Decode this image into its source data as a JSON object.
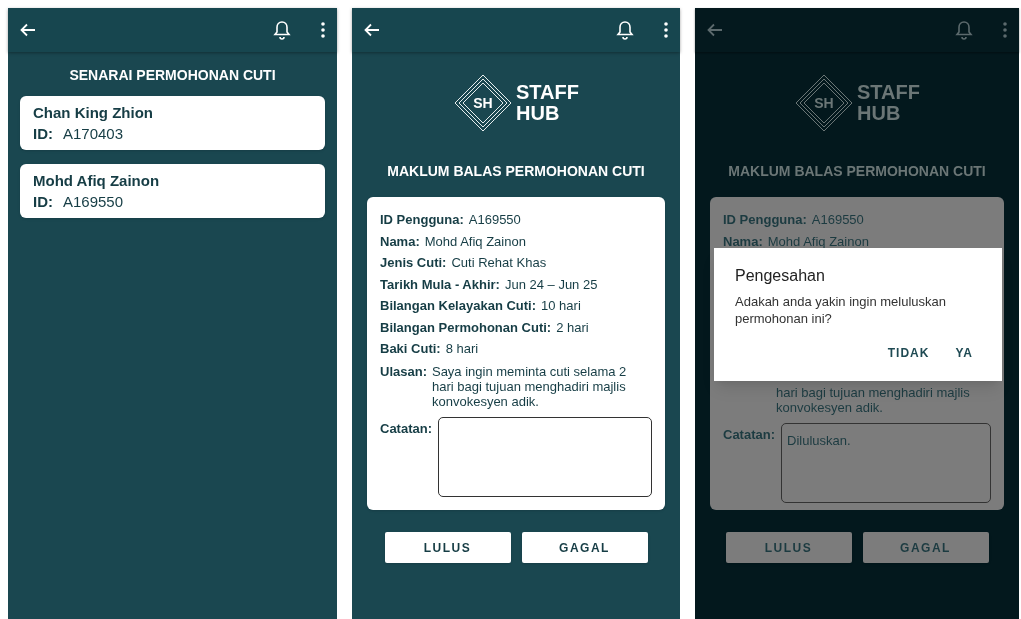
{
  "screens": [
    {
      "kind": "list",
      "dimmed": false,
      "title": "SENARAI PERMOHONAN CUTI",
      "items": [
        {
          "name": "Chan King Zhion",
          "id_label": "ID:",
          "id": "A170403"
        },
        {
          "name": "Mohd Afiq Zainon",
          "id_label": "ID:",
          "id": "A169550"
        }
      ]
    },
    {
      "kind": "detail",
      "dimmed": false,
      "logo": {
        "mark": "SH",
        "line1": "STAFF",
        "line2": "HUB"
      },
      "title": "MAKLUM BALAS PERMOHONAN CUTI",
      "fields": [
        {
          "label": "ID Pengguna:",
          "value": "A169550"
        },
        {
          "label": "Nama:",
          "value": "Mohd Afiq Zainon"
        },
        {
          "label": "Jenis Cuti:",
          "value": "Cuti Rehat Khas"
        },
        {
          "label": "Tarikh Mula - Akhir:",
          "value": "Jun 24 – Jun 25"
        },
        {
          "label": "Bilangan Kelayakan Cuti:",
          "value": "10 hari"
        },
        {
          "label": "Bilangan Permohonan Cuti:",
          "value": "2 hari"
        },
        {
          "label": "Baki Cuti:",
          "value": "8 hari"
        }
      ],
      "ulasan": {
        "label": "Ulasan:",
        "lines": [
          "Saya ingin meminta cuti selama 2",
          "hari bagi tujuan menghadiri majlis",
          "konvokesyen adik."
        ]
      },
      "catatan": {
        "label": "Catatan:"
      },
      "buttons": [
        "LULUS",
        "GAGAL"
      ]
    },
    {
      "kind": "detail",
      "dimmed": true,
      "logo": {
        "mark": "SH",
        "line1": "STAFF",
        "line2": "HUB"
      },
      "title": "MAKLUM BALAS PERMOHONAN CUTI",
      "fields": [
        {
          "label": "ID Pengguna:",
          "value": "A169550"
        },
        {
          "label": "Nama:",
          "value": "Mohd Afiq Zainon"
        }
      ],
      "ulasan": {
        "lines": [
          "hari bagi tujuan menghadiri majlis",
          "konvokesyen adik."
        ]
      },
      "catatan": {
        "label": "Catatan:",
        "value": "Diluluskan."
      },
      "buttons": [
        "LULUS",
        "GAGAL"
      ],
      "dialog": {
        "title": "Pengesahan",
        "message": "Adakah anda yakin ingin meluluskan permohonan ini?",
        "actions": [
          "TIDAK",
          "YA"
        ]
      }
    }
  ]
}
